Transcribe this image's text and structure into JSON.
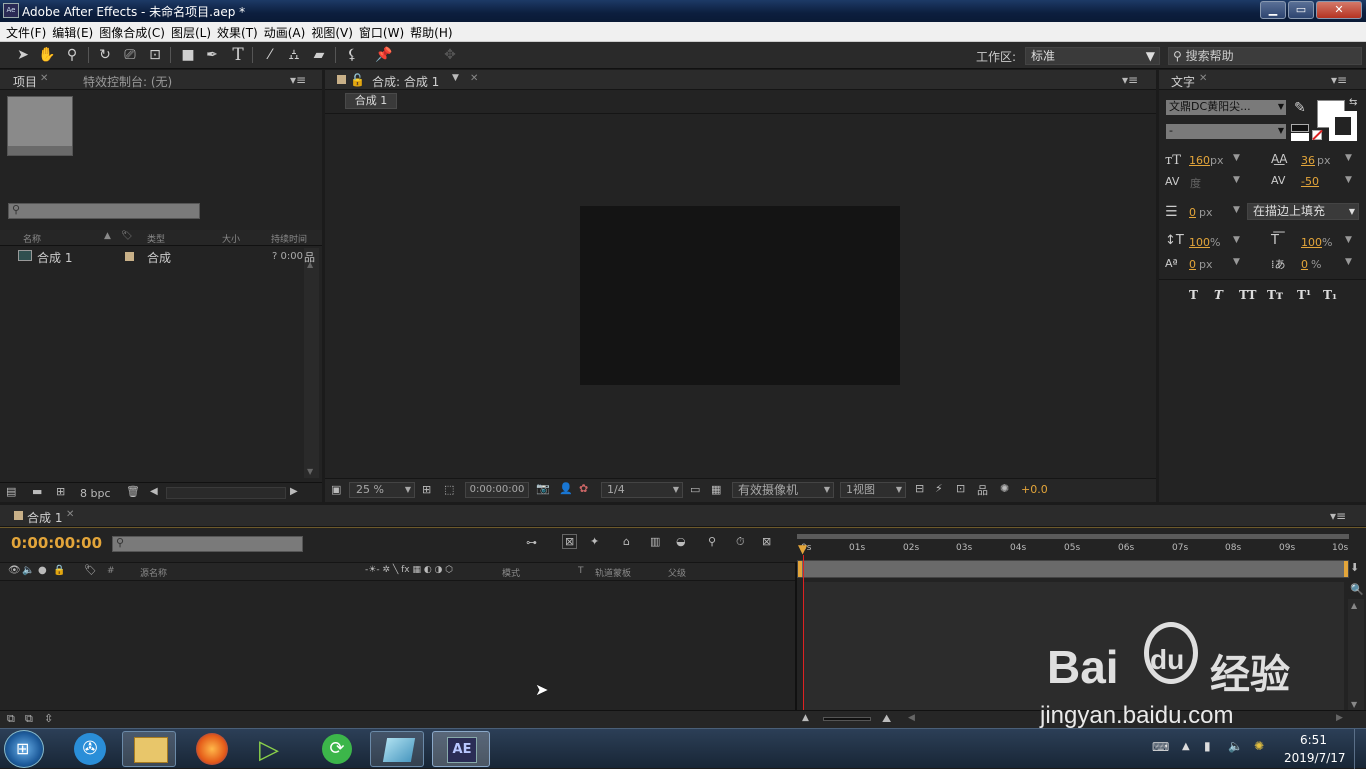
{
  "window": {
    "title": "Adobe After Effects - 未命名项目.aep *",
    "app_icon": "Ae",
    "minimize": "▁",
    "restore": "▭",
    "close": "✕"
  },
  "menu": [
    "文件(F)",
    "编辑(E)",
    "图像合成(C)",
    "图层(L)",
    "效果(T)",
    "动画(A)",
    "视图(V)",
    "窗口(W)",
    "帮助(H)"
  ],
  "toolbar": {
    "workspace_label": "工作区:",
    "workspace_value": "标准",
    "search_placeholder": "搜索帮助",
    "tools": [
      "selection-tool-icon",
      "hand-tool-icon",
      "zoom-tool-icon",
      "rotate-tool-icon",
      "camera-tool-icon",
      "pan-behind-tool-icon",
      "rectangle-tool-icon",
      "pen-tool-icon",
      "text-tool-icon",
      "brush-tool-icon",
      "clone-stamp-tool-icon",
      "eraser-tool-icon",
      "roto-brush-tool-icon",
      "puppet-pin-tool-icon"
    ]
  },
  "project_panel": {
    "tab_project": "项目",
    "tab_effects": "特效控制台: (无)",
    "col_name": "名称",
    "col_type": "类型",
    "col_size": "大小",
    "col_duration": "持续时间",
    "rows": [
      {
        "name": "合成 1",
        "type": "合成",
        "duration": "? 0:00"
      }
    ],
    "bpc": "8 bpc"
  },
  "composition_panel": {
    "tab": "合成: 合成 1",
    "crumb": "合成 1",
    "zoom": "25 %",
    "timecode": "0:00:00:00",
    "resolution": "1/4",
    "camera": "有效摄像机",
    "views": "1视图",
    "exposure": "+0.0"
  },
  "character_panel": {
    "tab": "文字",
    "font": "文鼎DC黄阳尖...",
    "style": "-",
    "font_size": "160",
    "font_size_unit": "px",
    "leading": "36",
    "leading_unit": "px",
    "kerning": "度",
    "tracking": "-50",
    "stroke_width": "0",
    "stroke_unit": "px",
    "stroke_mode": "在描边上填充",
    "vscale": "100",
    "vscale_unit": "%",
    "hscale": "100",
    "hscale_unit": "%",
    "baseline": "0",
    "baseline_unit": "px",
    "tsume": "0",
    "tsume_unit": "%",
    "styles": [
      "T",
      "T",
      "TT",
      "Tт",
      "T¹",
      "T₁"
    ]
  },
  "timeline": {
    "tab": "合成 1",
    "timecode": "0:00:00:00",
    "col_source": "源名称",
    "col_mode": "模式",
    "col_t": "T",
    "col_trkmat": "轨道蒙板",
    "col_parent": "父级",
    "col_hash": "#",
    "ruler": [
      "0s",
      "01s",
      "02s",
      "03s",
      "04s",
      "05s",
      "06s",
      "07s",
      "08s",
      "09s",
      "10s"
    ]
  },
  "watermark": {
    "brand": "Bai",
    "brand2": "du",
    "cn": "经验",
    "url": "jingyan.baidu.com"
  },
  "taskbar": {
    "time": "6:51",
    "date": "2019/7/17",
    "ae_label": "AE"
  }
}
